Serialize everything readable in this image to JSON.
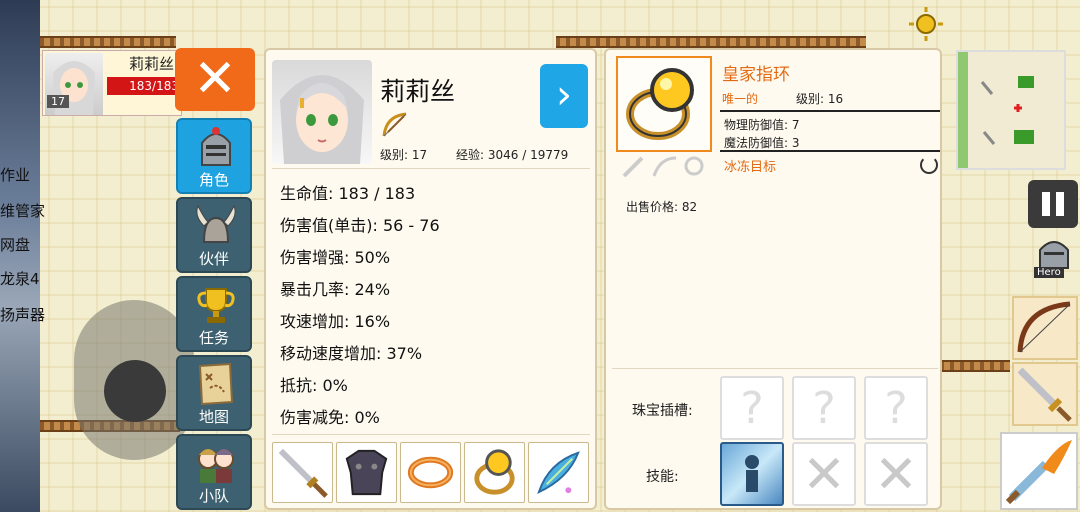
{
  "desktop": {
    "lines": [
      "作业",
      "维管家",
      "网盘",
      "龙泉4",
      "扬声器"
    ]
  },
  "hero_card": {
    "name": "莉莉丝",
    "hp": "183/183",
    "level": "17"
  },
  "menu": {
    "close_label": "✕",
    "tabs": [
      {
        "label": "角色",
        "icon": "knight-helmet-icon"
      },
      {
        "label": "伙伴",
        "icon": "horned-helmet-icon"
      },
      {
        "label": "任务",
        "icon": "trophy-icon"
      },
      {
        "label": "地图",
        "icon": "map-scroll-icon"
      },
      {
        "label": "小队",
        "icon": "party-icon"
      }
    ]
  },
  "character": {
    "name": "莉莉丝",
    "level_text": "级别: 17",
    "exp_text": "经验: 3046 / 19779",
    "next_label": "›",
    "stats": [
      "生命值: 183 / 183",
      "伤害值(单击): 56 - 76",
      "伤害增强: 50%",
      "暴击几率: 24%",
      "攻速增加: 16%",
      "移动速度增加: 37%",
      "抵抗: 0%",
      "伤害减免: 0%"
    ],
    "equipment": [
      "sword-icon",
      "armor-icon",
      "bracelet-icon",
      "ring-icon",
      "feather-charm-icon"
    ]
  },
  "item": {
    "name": "皇家指环",
    "rarity": "唯一的",
    "level_text": "级别: 16",
    "stats": [
      "物理防御值: 7",
      "魔法防御值: 3"
    ],
    "effect": "冰冻目标",
    "sell_price": "出售价格: 82",
    "gem_label": "珠宝插槽:",
    "skill_label": "技能:",
    "gem_slot_glyph": "?"
  },
  "hud": {
    "hero_label": "Hero"
  },
  "colors": {
    "accent_orange": "#f06a1a",
    "accent_blue": "#1fa3e0",
    "tab_dark": "#3d6170",
    "rarity": "#e46a12"
  }
}
